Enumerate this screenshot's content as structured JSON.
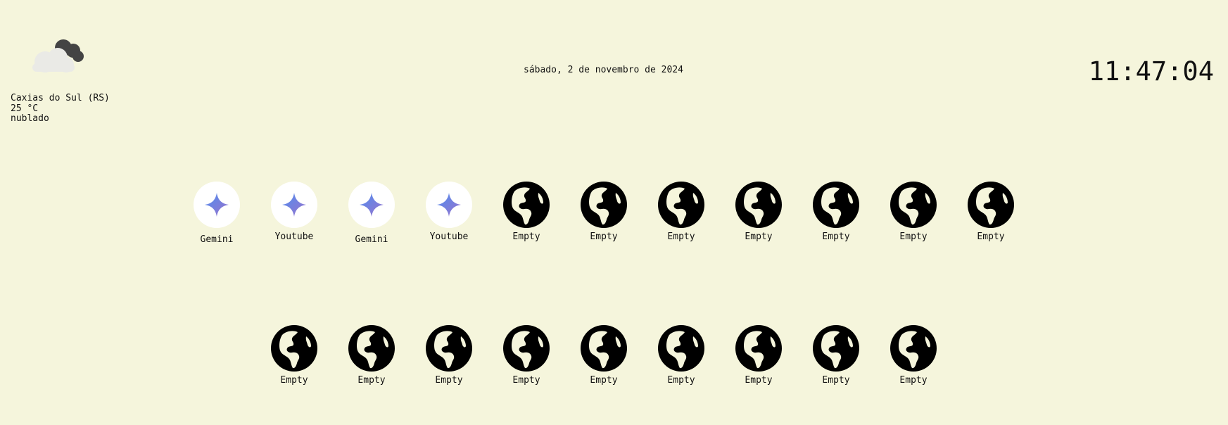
{
  "weather": {
    "icon": "cloudy-icon",
    "city": "Caxias do Sul (RS)",
    "temperature": "25 °C",
    "condition": "nublado"
  },
  "date": "sábado, 2 de novembro de 2024",
  "clock": "11:47:04",
  "shortcuts": {
    "row1": [
      {
        "label": "Gemini",
        "icon": "gemini-icon"
      },
      {
        "label": "Youtube",
        "icon": "gemini-icon"
      },
      {
        "label": "Gemini",
        "icon": "gemini-icon"
      },
      {
        "label": "Youtube",
        "icon": "gemini-icon"
      },
      {
        "label": "Empty",
        "icon": "globe-icon"
      },
      {
        "label": "Empty",
        "icon": "globe-icon"
      },
      {
        "label": "Empty",
        "icon": "globe-icon"
      },
      {
        "label": "Empty",
        "icon": "globe-icon"
      },
      {
        "label": "Empty",
        "icon": "globe-icon"
      },
      {
        "label": "Empty",
        "icon": "globe-icon"
      },
      {
        "label": "Empty",
        "icon": "globe-icon"
      }
    ],
    "row2": [
      {
        "label": "Empty",
        "icon": "globe-icon"
      },
      {
        "label": "Empty",
        "icon": "globe-icon"
      },
      {
        "label": "Empty",
        "icon": "globe-icon"
      },
      {
        "label": "Empty",
        "icon": "globe-icon"
      },
      {
        "label": "Empty",
        "icon": "globe-icon"
      },
      {
        "label": "Empty",
        "icon": "globe-icon"
      },
      {
        "label": "Empty",
        "icon": "globe-icon"
      },
      {
        "label": "Empty",
        "icon": "globe-icon"
      },
      {
        "label": "Empty",
        "icon": "globe-icon"
      }
    ]
  },
  "colors": {
    "background": "#f5f5dc",
    "gemini_gradient_start": "#4f8ef0",
    "gemini_gradient_end": "#9b72cb",
    "globe": "#000000"
  }
}
